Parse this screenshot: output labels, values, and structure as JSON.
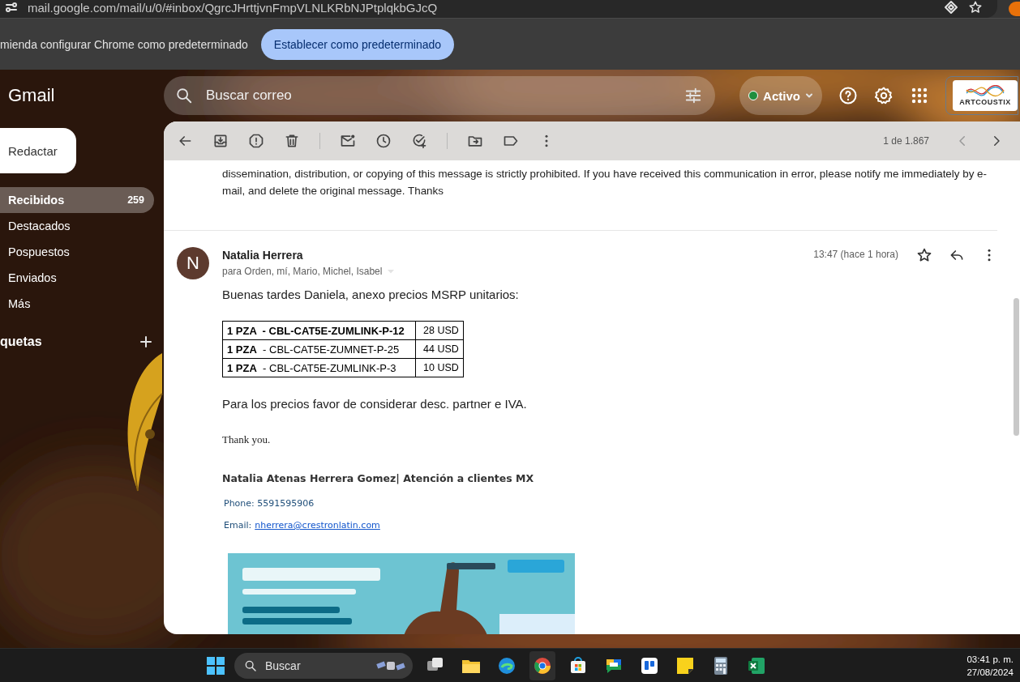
{
  "browser": {
    "url": "mail.google.com/mail/u/0/#inbox/QgrcJHrttjvnFmpVLNLKRbNJPtplqkbGJcQ",
    "infobar": {
      "message": "mienda configurar Chrome como predeterminado",
      "button": "Establecer como predeterminado"
    }
  },
  "gmail": {
    "logo": "Gmail",
    "compose": "Redactar",
    "nav": [
      {
        "label": "Recibidos",
        "count": "259",
        "selected": true
      },
      {
        "label": "Destacados",
        "selected": false
      },
      {
        "label": "Pospuestos",
        "selected": false
      },
      {
        "label": "Enviados",
        "selected": false
      },
      {
        "label": "Más",
        "selected": false
      }
    ],
    "labels_heading": "quetas",
    "search": {
      "placeholder": "Buscar correo"
    },
    "status": {
      "label": "Activo"
    },
    "account_logo": "ARTCOUSTIX"
  },
  "toolbar": {
    "counter": "1 de 1.867"
  },
  "message": {
    "previous_text": "dissemination, distribution, or copying of this message is strictly prohibited. If you have received this communication in error, please notify me immediately by e-mail, and delete the original message. Thanks",
    "initial": "N",
    "sender": "Natalia Herrera",
    "recipients": "para Orden, mí, Mario, Michel, Isabel",
    "time": "13:47 (hace 1 hora)",
    "greeting": "Buenas tardes Daniela, anexo precios MSRP unitarios:",
    "table": [
      {
        "item": "**1 PZA  - CBL-CAT5E-ZUMLINK-P-12**",
        "price": "28 USD"
      },
      {
        "item": "**1 PZA**  - CBL-CAT5E-ZUMNET-P-25",
        "price": "44 USD"
      },
      {
        "item": "**1 PZA**  - CBL-CAT5E-ZUMLINK-P-3",
        "price": "10 USD"
      }
    ],
    "note": "Para los precios favor de considerar desc. partner e IVA.",
    "thanks": "Thank you.",
    "signature": {
      "name": "Natalia Atenas Herrera Gomez| Atención a clientes MX",
      "phone": "Phone: 5591595906",
      "email_label": "Email:",
      "email": "nherrera@crestronlatin.com"
    }
  },
  "taskbar": {
    "search": "Buscar",
    "time": "03:41 p. m.",
    "date": "27/08/2024"
  }
}
